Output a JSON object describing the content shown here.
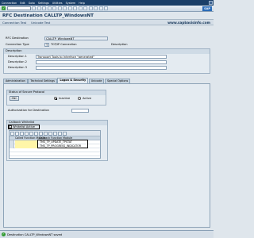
{
  "menu": [
    "Connection",
    "Edit",
    "Goto",
    "Settings",
    "Utilities",
    "System",
    "Help"
  ],
  "title": "RFC Destination CALLTP_WindowsNT",
  "app_toolbar": [
    "Connection Test",
    "Unicode Test"
  ],
  "watermark": "www.sapbasisinfo.com",
  "header": {
    "rfc_dest_label": "RFC Destination",
    "rfc_dest_value": "CALLTP_WindowsNT",
    "conn_type_label": "Connection Type",
    "conn_type_code": "T",
    "conn_type_desc": "TCP/IP Connection",
    "desc_col_label": "Description"
  },
  "description": {
    "frame_title": "Description",
    "d1_label": "Description 1",
    "d1_value": "Transport Tools tp Interface                  \"generated\"",
    "d2_label": "Description 2",
    "d3_label": "Description 3"
  },
  "tabs": [
    "Administration",
    "Technical Settings",
    "Logon & Security",
    "Unicode",
    "Special Options"
  ],
  "active_tab": 2,
  "secure_protocol": {
    "frame_title": "Status of Secure Protocol",
    "snc_button": "SNC",
    "inactive_label": "Inactive",
    "active_label": "Active",
    "selected": "inactive"
  },
  "authorization": {
    "label": "Authorization for Destination"
  },
  "callback": {
    "frame_title": "Callback Whitelist",
    "checkbox_label": "Whitelist Active",
    "checked": true,
    "col1": "Called Function Module",
    "col2": "Callback Function Module",
    "rows": [
      "TMS_TP_UPDATE_TPSTAT",
      "TMS_TP_PROGRESS_INDICATOR"
    ]
  },
  "status": {
    "message": "Destination CALLTP_WindowsNT saved"
  },
  "colors": {
    "sap_blue": "#1a3f68",
    "highlight_yellow": "#fff6a8",
    "ok_green": "#2f9a2f"
  }
}
